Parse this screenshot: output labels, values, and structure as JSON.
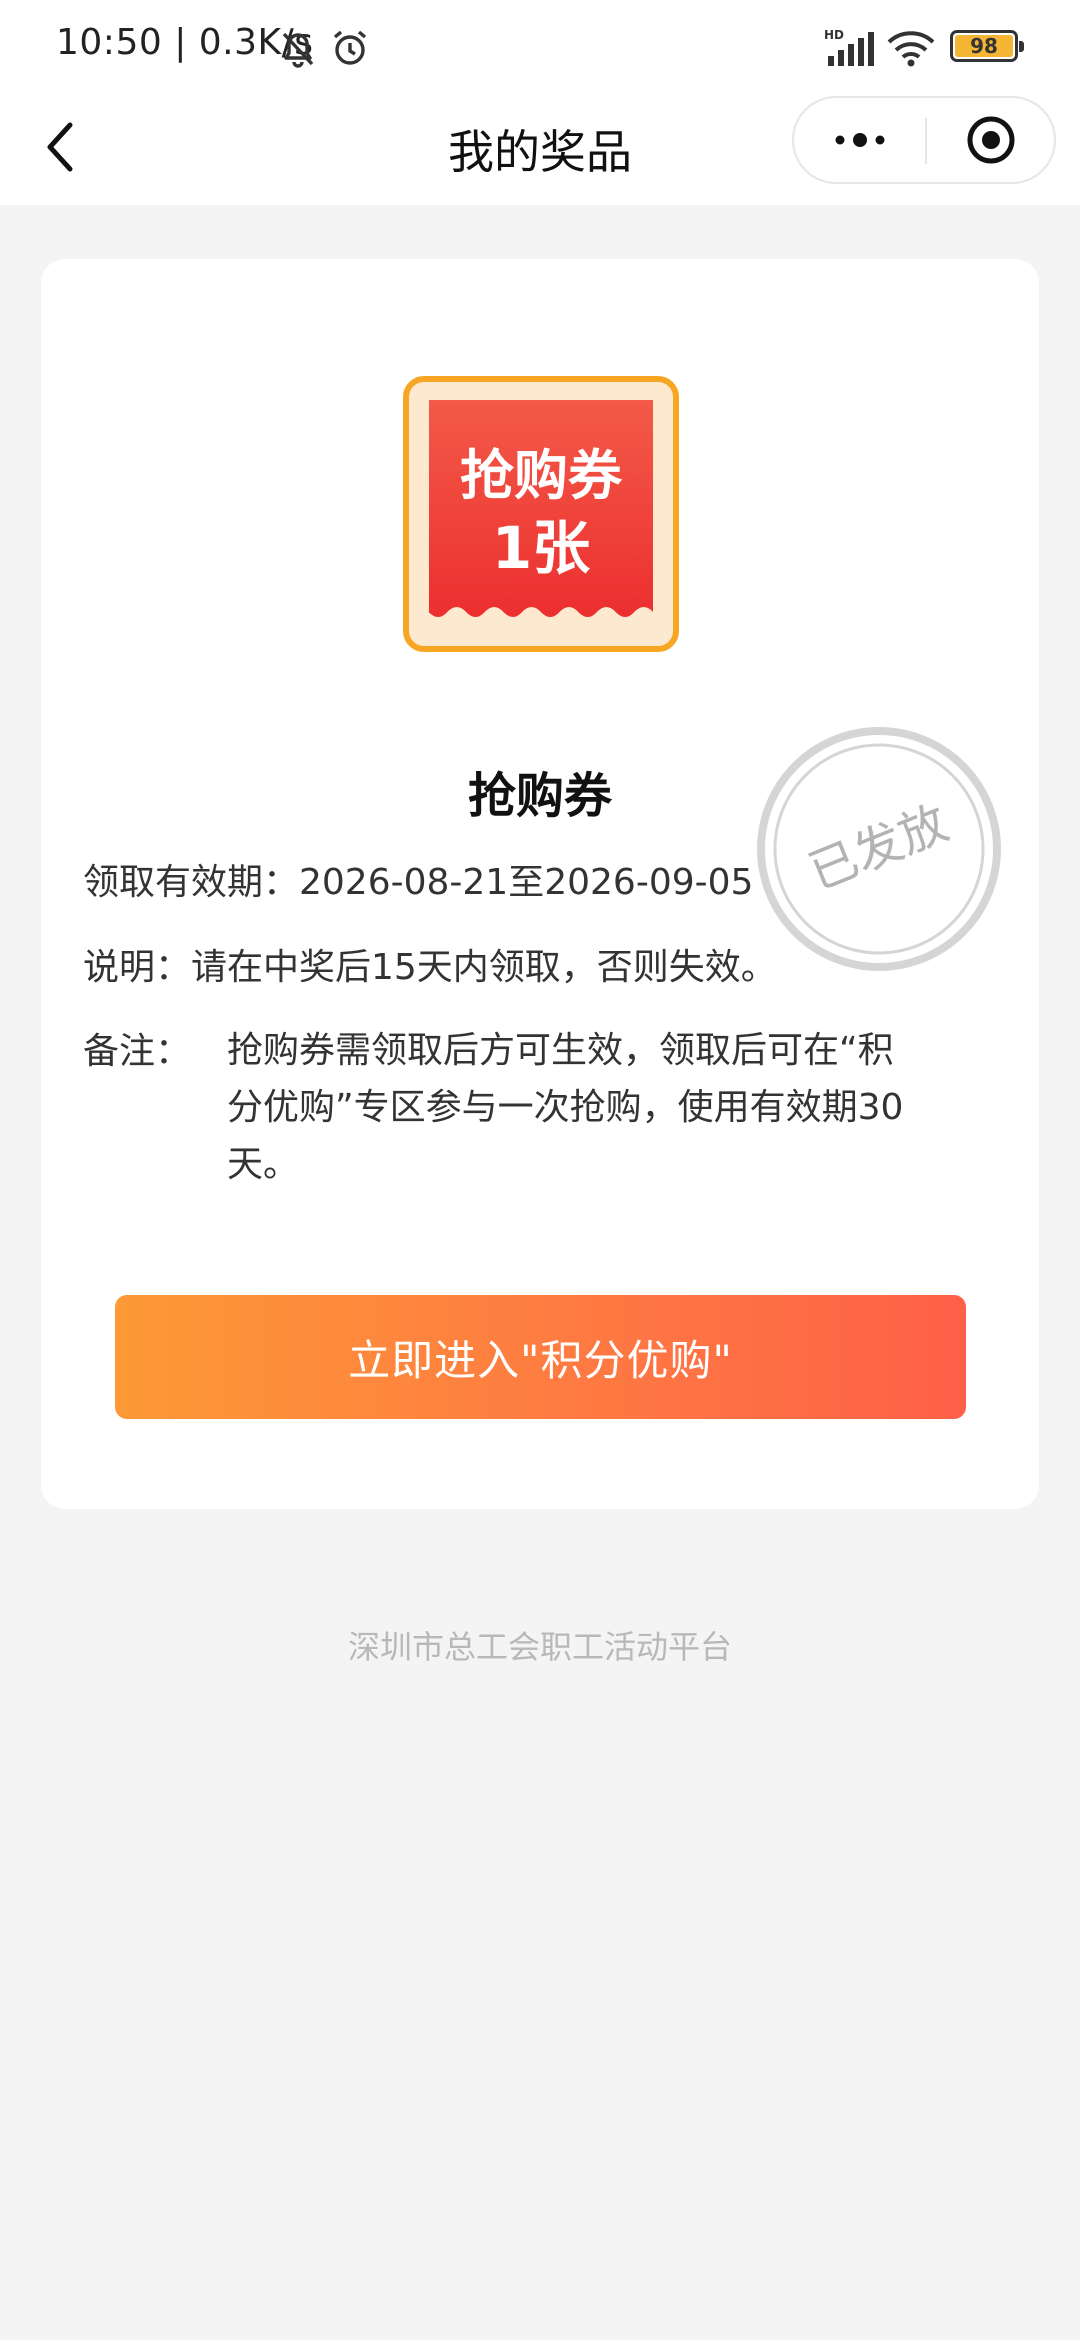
{
  "status_bar": {
    "time_speed": "10:50 | 0.3K/s",
    "network": "HD",
    "battery": "98"
  },
  "nav": {
    "title": "我的奖品"
  },
  "prize": {
    "image_text_line1": "抢购券",
    "image_text_line2": "1张",
    "name": "抢购券",
    "validity": "领取有效期：2026-08-21至2026-09-05",
    "description": "说明：请在中奖后15天内领取，否则失效。",
    "remark_label": "备注：",
    "remark_text": "抢购券需领取后方可生效，领取后可在“积分优购”专区参与一次抢购，使用有效期30天。",
    "stamp": "已发放"
  },
  "action": {
    "button_label": "立即进入\"积分优购\""
  },
  "footer": {
    "text": "深圳市总工会职工活动平台"
  },
  "colors": {
    "accent_start": "#fd9936",
    "accent_end": "#fe6047",
    "coupon_red": "#ef3d34",
    "coupon_border": "#f7a623"
  }
}
